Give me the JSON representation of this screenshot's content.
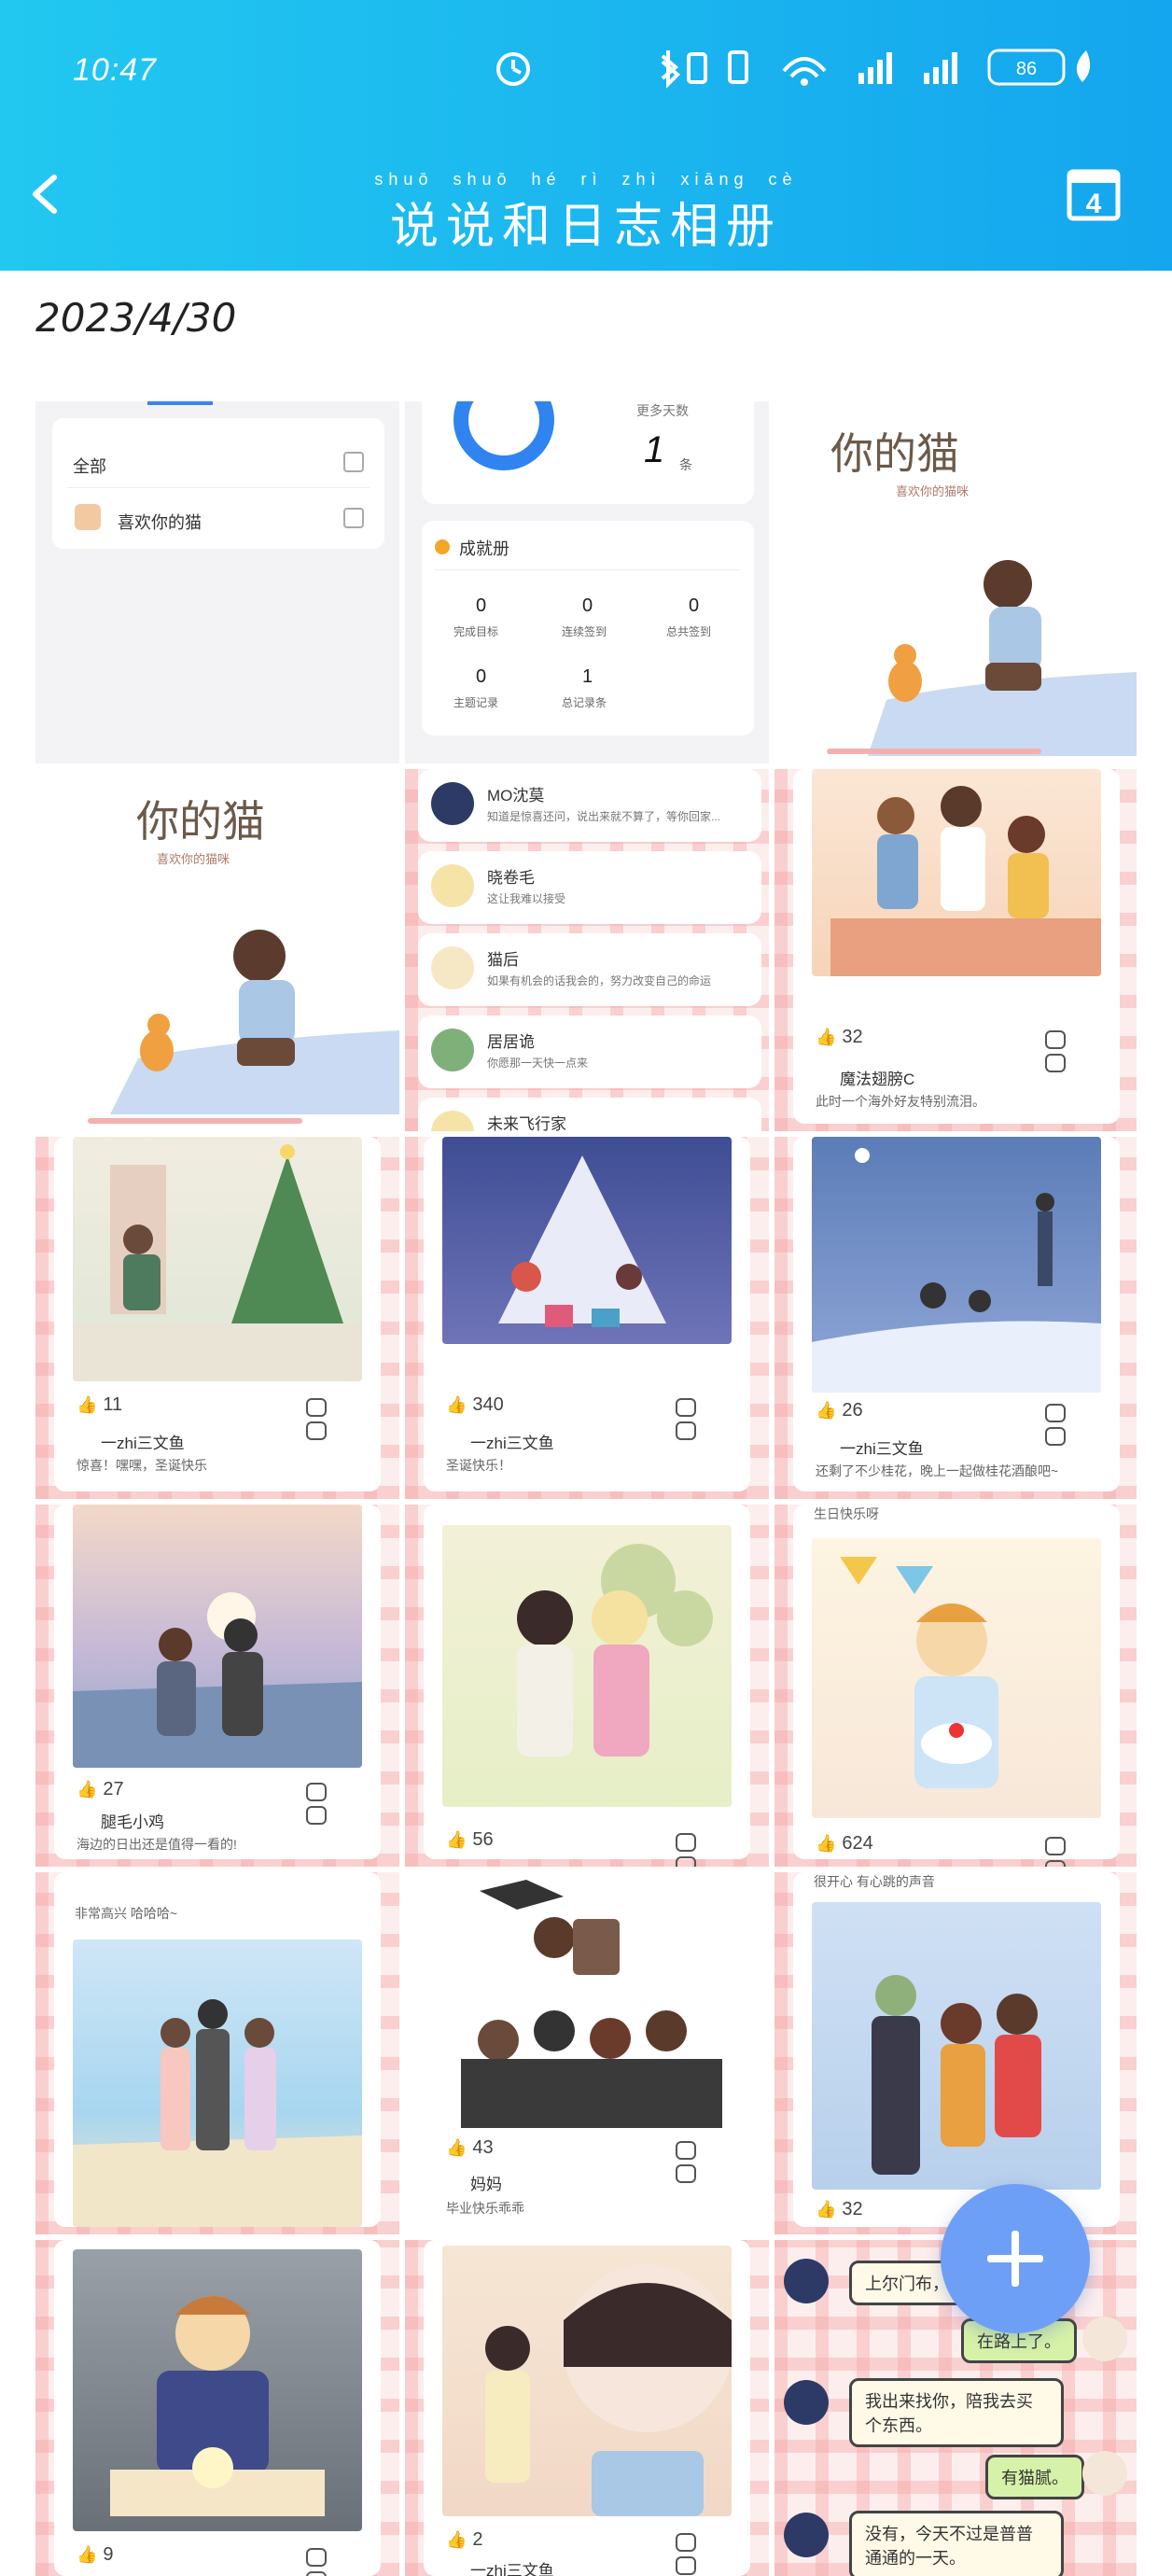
{
  "status_bar": {
    "time": "10:47",
    "battery": "86"
  },
  "header": {
    "title": "说说和日志相册",
    "pinyin": "shuō shuō hé rì zhì xiāng cè",
    "calendar_day": "4"
  },
  "date": "2023/4/30",
  "settings_panel": {
    "rows": [
      "全部",
      "喜欢你的猫"
    ],
    "count_value": "1",
    "count_unit": "条",
    "count_top": "更多天数",
    "section_title": "成就册",
    "stats": [
      {
        "value": "0",
        "label": "完成目标"
      },
      {
        "value": "0",
        "label": "连续签到"
      },
      {
        "value": "0",
        "label": "总共签到"
      },
      {
        "value": "0",
        "label": "主题记录"
      },
      {
        "value": "1",
        "label": "总记录条"
      }
    ]
  },
  "cover_title": "你的猫",
  "cover_sub": "喜欢你的猫咪",
  "contacts": [
    {
      "name": "MO沈莫",
      "msg": "知道是惊喜还问，说出来就不算了，等你回家..."
    },
    {
      "name": "晓卷毛",
      "msg": "这让我难以接受"
    },
    {
      "name": "猫后",
      "msg": "如果有机会的话我会的，努力改变自己的命运"
    },
    {
      "name": "居居诡",
      "msg": "你愿那一天快一点来"
    },
    {
      "name": "未来飞行家",
      "msg": ""
    }
  ],
  "posts": [
    {
      "likes": "32",
      "user": "魔法翅膀C",
      "caption": "此时一个海外好友特别流泪。"
    },
    {
      "likes": "11",
      "user": "一zhi三文鱼",
      "caption": "惊喜！嘿嘿，圣诞快乐"
    },
    {
      "likes": "340",
      "user": "一zhi三文鱼",
      "caption": "圣诞快乐！"
    },
    {
      "likes": "26",
      "user": "一zhi三文鱼",
      "caption": "还剩了不少桂花，晚上一起做桂花酒酿吧~"
    },
    {
      "likes": "27",
      "user": "腿毛小鸡",
      "caption": "海边的日出还是值得一看的!"
    },
    {
      "likes": "56",
      "user": "",
      "caption": ""
    },
    {
      "likes": "624",
      "user": "",
      "caption": "生日快乐呀"
    },
    {
      "likes": "",
      "user": "",
      "caption": "非常高兴 哈哈哈~"
    },
    {
      "likes": "43",
      "user": "妈妈",
      "caption": "毕业快乐乖乖"
    },
    {
      "likes": "32",
      "user": "",
      "caption": "很开心 有心跳的声音"
    },
    {
      "likes": "9",
      "user": "",
      "caption": ""
    },
    {
      "likes": "2",
      "user": "一zhi三文鱼",
      "caption": ""
    }
  ],
  "chat": {
    "messages": [
      {
        "from": "other",
        "text": "上尔门布，价"
      },
      {
        "from": "me",
        "text": "在路上了。"
      },
      {
        "from": "other",
        "text": "我出来找你，陪我去买个东西。"
      },
      {
        "from": "me",
        "text": "有猫腻。"
      },
      {
        "from": "other",
        "text": "没有，今天不过是普普通通的一天。"
      }
    ]
  },
  "colors": {
    "header_start": "#22c8f0",
    "header_end": "#14a6ee",
    "fab": "#6e9ff7",
    "plaid": "#fdeeee"
  }
}
